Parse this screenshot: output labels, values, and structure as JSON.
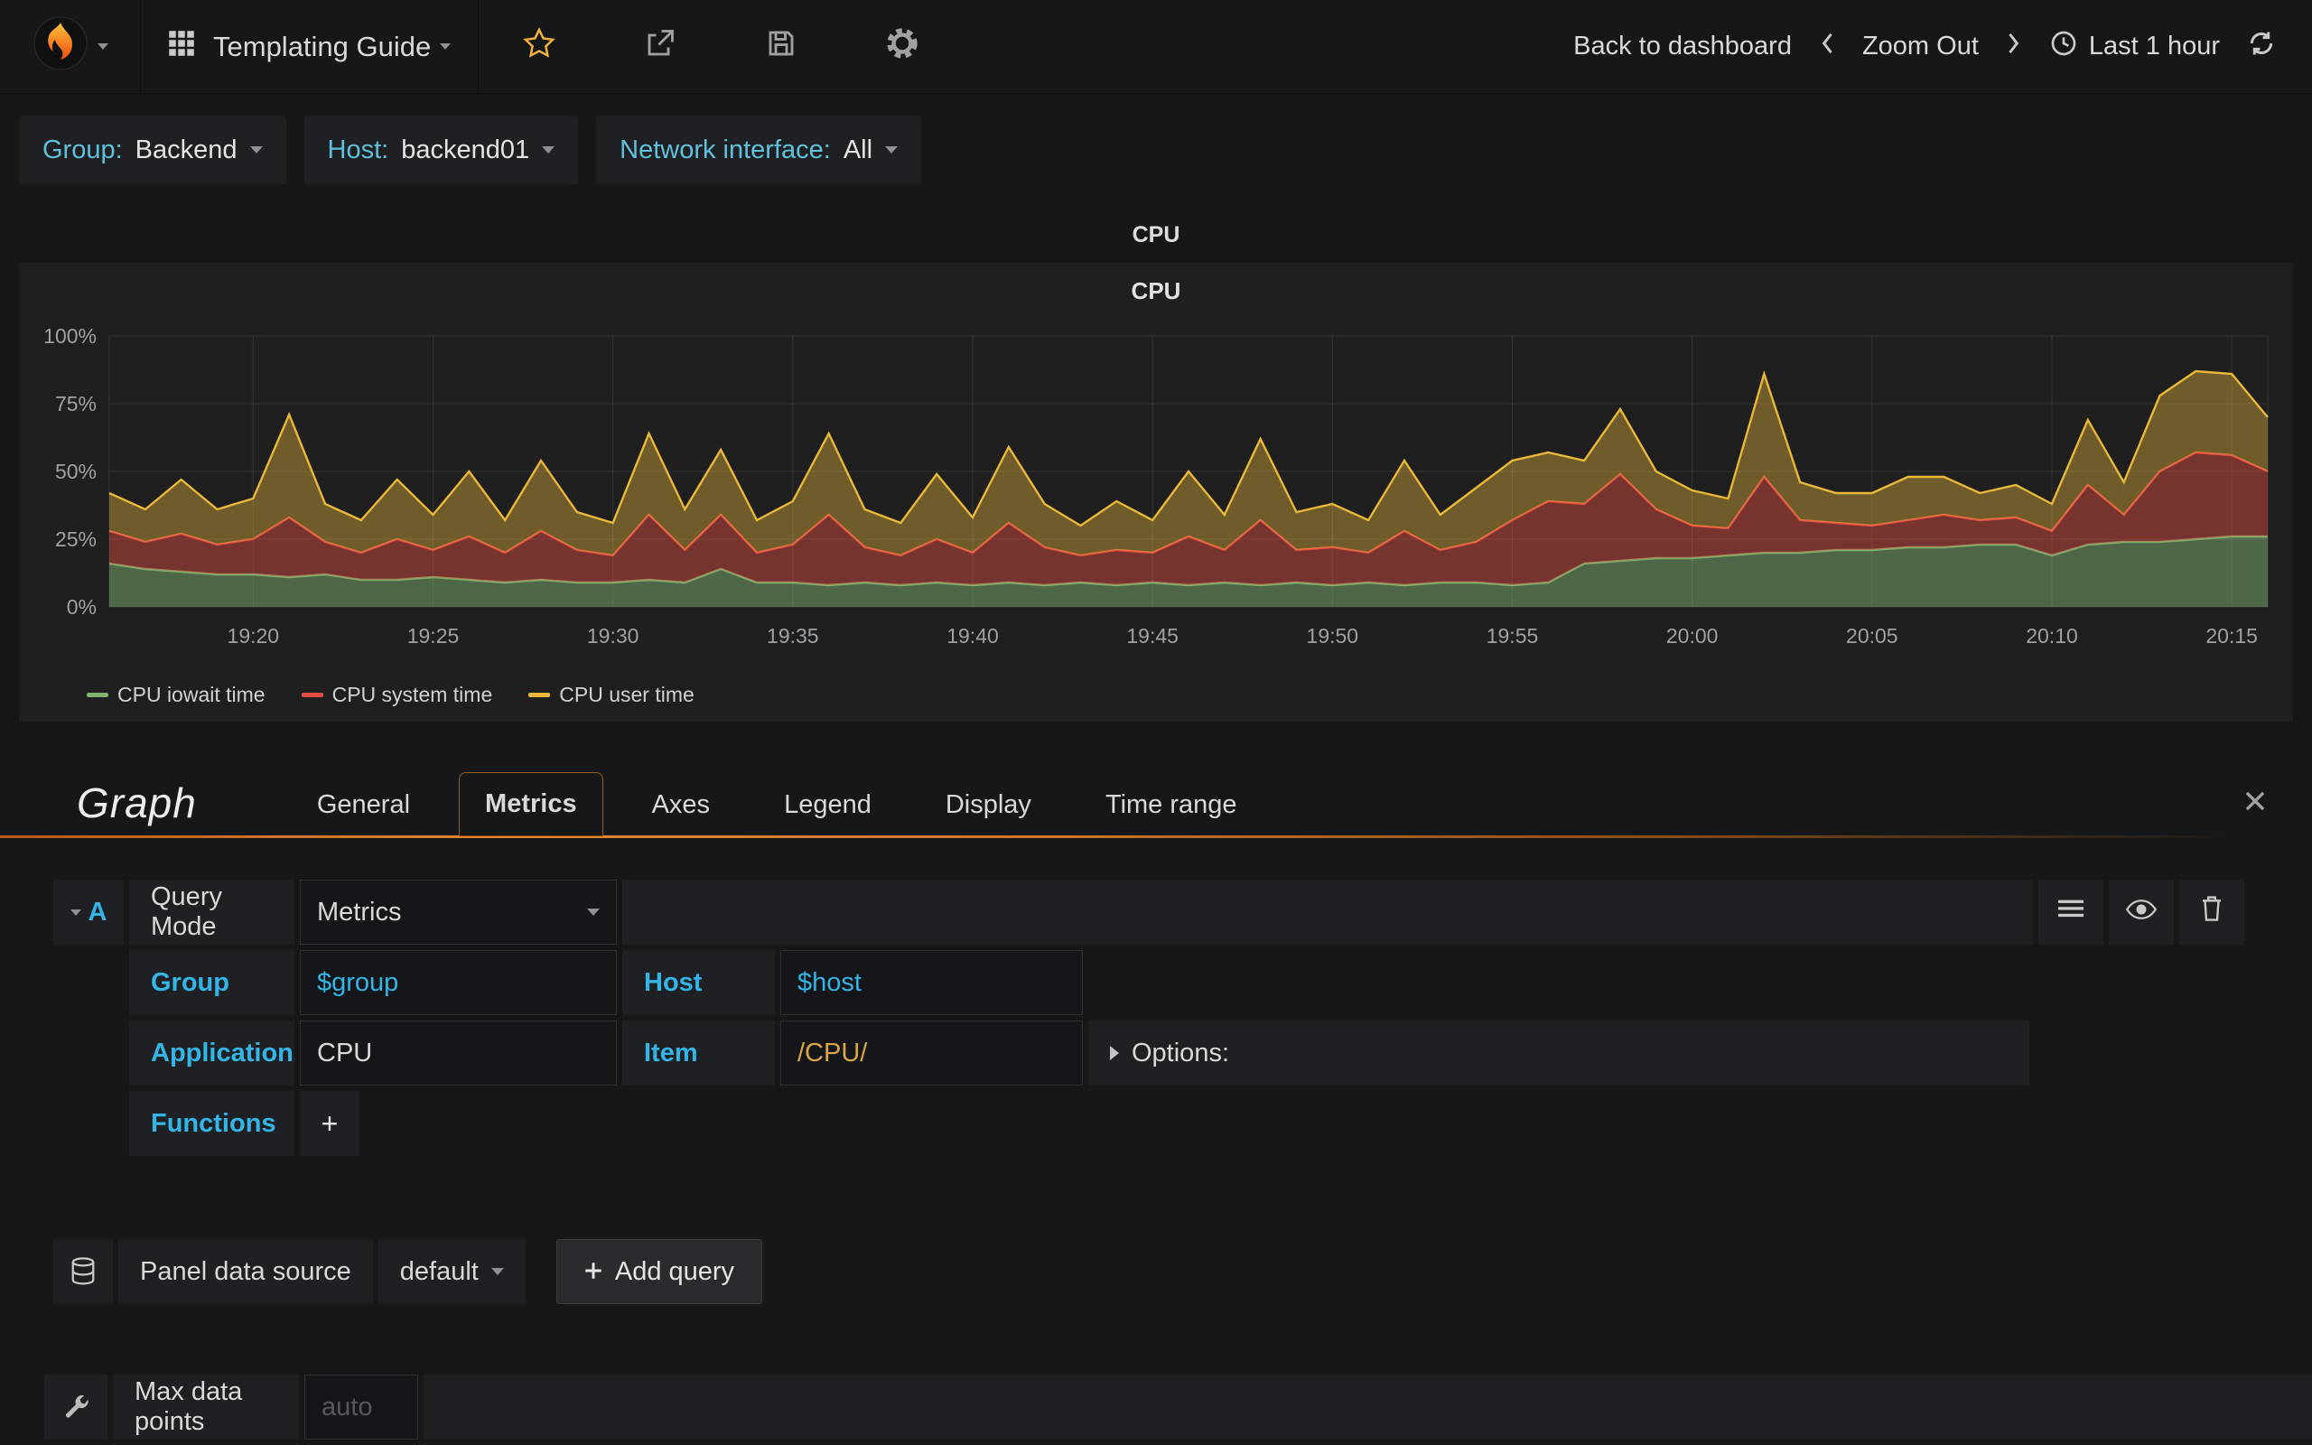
{
  "navbar": {
    "dashboard_title": "Templating Guide",
    "back_to_dashboard": "Back to dashboard",
    "zoom_out": "Zoom Out",
    "time_range": "Last 1 hour"
  },
  "template_vars": [
    {
      "label": "Group:",
      "value": "Backend"
    },
    {
      "label": "Host:",
      "value": "backend01"
    },
    {
      "label": "Network interface:",
      "value": "All"
    }
  ],
  "panel": {
    "title": "CPU"
  },
  "editor": {
    "panel_type": "Graph",
    "tabs": [
      "General",
      "Metrics",
      "Axes",
      "Legend",
      "Display",
      "Time range"
    ],
    "active_tab": "Metrics",
    "query": {
      "letter": "A",
      "query_mode_label": "Query Mode",
      "query_mode_value": "Metrics",
      "group_label": "Group",
      "group_value": "$group",
      "host_label": "Host",
      "host_value": "$host",
      "application_label": "Application",
      "application_value": "CPU",
      "item_label": "Item",
      "item_value": "/CPU/",
      "options_label": "Options:",
      "functions_label": "Functions",
      "add_function": "+"
    },
    "datasource": {
      "label": "Panel data source",
      "value": "default",
      "add_query": "Add query"
    },
    "max_data_points": {
      "label": "Max data points",
      "placeholder": "auto"
    }
  },
  "colors": {
    "accent_cyan": "#33b5e5",
    "template_label": "#5fc2da",
    "item_value_gold": "#d8a74a",
    "star_yellow": "#f2b03f",
    "tab_accent_orange": "#e8862d",
    "series_green": "#7eb26d",
    "series_red": "#e24d42",
    "series_yellow": "#eab839"
  },
  "chart_data": {
    "type": "area",
    "stacked": true,
    "title": "CPU",
    "ylabel": "",
    "xlabel": "",
    "ylim": [
      0,
      100
    ],
    "y_ticks": [
      "0%",
      "25%",
      "50%",
      "75%",
      "100%"
    ],
    "x_start": "19:16",
    "x_end": "20:16",
    "x_span_min": 60,
    "grid": true,
    "legend_position": "bottom-left",
    "x_ticks": [
      {
        "label": "19:20",
        "m": 4
      },
      {
        "label": "19:25",
        "m": 9
      },
      {
        "label": "19:30",
        "m": 14
      },
      {
        "label": "19:35",
        "m": 19
      },
      {
        "label": "19:40",
        "m": 24
      },
      {
        "label": "19:45",
        "m": 29
      },
      {
        "label": "19:50",
        "m": 34
      },
      {
        "label": "19:55",
        "m": 39
      },
      {
        "label": "20:00",
        "m": 44
      },
      {
        "label": "20:05",
        "m": 49
      },
      {
        "label": "20:10",
        "m": 54
      },
      {
        "label": "20:15",
        "m": 59
      }
    ],
    "series": [
      {
        "name": "CPU iowait time",
        "color": "#7eb26d",
        "fill": "rgba(126,178,109,0.5)",
        "values": [
          16,
          14,
          13,
          12,
          12,
          11,
          12,
          10,
          10,
          11,
          10,
          9,
          10,
          9,
          9,
          10,
          9,
          14,
          9,
          9,
          8,
          9,
          8,
          9,
          8,
          9,
          8,
          9,
          8,
          9,
          8,
          9,
          8,
          9,
          8,
          9,
          8,
          9,
          9,
          8,
          9,
          16,
          17,
          18,
          18,
          19,
          20,
          20,
          21,
          21,
          22,
          22,
          23,
          23,
          19,
          23,
          24,
          24,
          25,
          26,
          26
        ]
      },
      {
        "name": "CPU system time",
        "color": "#e24d42",
        "fill": "rgba(226,77,66,0.45)",
        "values": [
          12,
          10,
          14,
          11,
          13,
          22,
          12,
          10,
          15,
          10,
          16,
          11,
          18,
          12,
          10,
          24,
          12,
          20,
          11,
          14,
          26,
          13,
          11,
          16,
          12,
          22,
          14,
          10,
          13,
          11,
          18,
          12,
          24,
          12,
          14,
          11,
          20,
          12,
          15,
          24,
          30,
          22,
          32,
          18,
          12,
          10,
          28,
          12,
          10,
          9,
          10,
          12,
          9,
          10,
          9,
          22,
          10,
          26,
          32,
          30,
          24
        ]
      },
      {
        "name": "CPU user time",
        "color": "#eab839",
        "fill": "rgba(234,184,57,0.4)",
        "values": [
          14,
          12,
          20,
          13,
          15,
          38,
          14,
          12,
          22,
          13,
          24,
          12,
          26,
          14,
          12,
          30,
          15,
          24,
          12,
          16,
          30,
          14,
          12,
          24,
          13,
          28,
          16,
          11,
          18,
          12,
          24,
          13,
          30,
          14,
          16,
          12,
          26,
          13,
          20,
          22,
          18,
          16,
          24,
          14,
          13,
          11,
          38,
          14,
          11,
          12,
          16,
          14,
          10,
          12,
          10,
          24,
          12,
          28,
          30,
          30,
          20
        ]
      }
    ]
  }
}
